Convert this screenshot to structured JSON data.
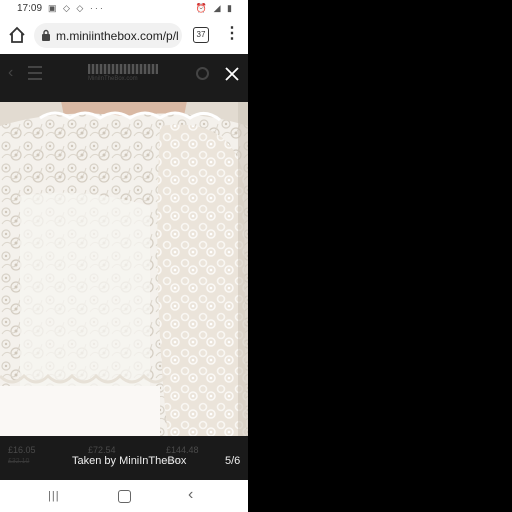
{
  "status_bar": {
    "time": "17:09",
    "left_icons": "▣ ◇ ◇ ···",
    "right_icons": "⏰ ◢ ▮"
  },
  "browser": {
    "url": "m.miniinthebox.com/p/l",
    "tab_count": "37"
  },
  "site_header": {
    "logo_sub": "MiniInTheBox.com"
  },
  "lightbox": {
    "caption": "Taken by MiniInTheBox",
    "counter": "5/6"
  },
  "background_prices": [
    {
      "price": "£16.05",
      "old": "£32.10"
    },
    {
      "price": "£72.54",
      "old": ""
    },
    {
      "price": "£144.48",
      "old": "£288"
    }
  ],
  "colors": {
    "lightbox_bg": "#1a1a1a",
    "caption_text": "#f0f0f0",
    "lace": "#f6f3ee"
  }
}
